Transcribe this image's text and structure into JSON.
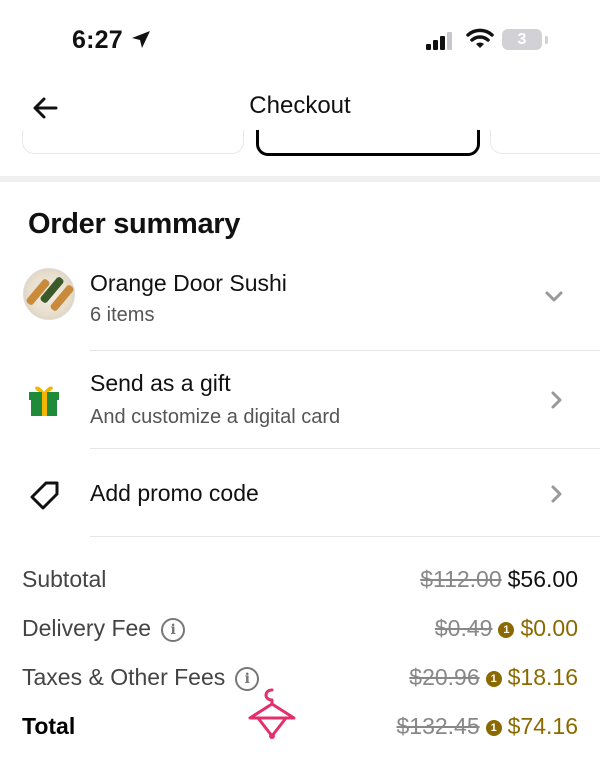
{
  "status": {
    "time": "6:27",
    "battery": "3"
  },
  "nav": {
    "title": "Checkout"
  },
  "order_summary": {
    "heading": "Order summary",
    "restaurant": {
      "name": "Orange Door Sushi",
      "items": "6 items"
    },
    "gift": {
      "title": "Send as a gift",
      "subtitle": "And customize a digital card"
    },
    "promo": {
      "title": "Add promo code"
    }
  },
  "fees": {
    "subtotal": {
      "label": "Subtotal",
      "old": "$112.00",
      "new": "$56.00"
    },
    "delivery": {
      "label": "Delivery Fee",
      "old": "$0.49",
      "new": "$0.00"
    },
    "taxes": {
      "label": "Taxes & Other Fees",
      "old": "$20.96",
      "new": "$18.16"
    },
    "total": {
      "label": "Total",
      "old": "$132.45",
      "new": "$74.16"
    }
  },
  "colors": {
    "member_price": "#8a6a00",
    "accent_overlay": "#e3306c"
  },
  "icons": {
    "back": "arrow-left-icon",
    "gift": "gift-icon",
    "promo": "tag-icon",
    "chevron_down": "chevron-down-icon",
    "chevron_right": "chevron-right-icon",
    "info": "info-icon",
    "membership": "uber-one-icon",
    "overlay": "hanger-icon"
  }
}
